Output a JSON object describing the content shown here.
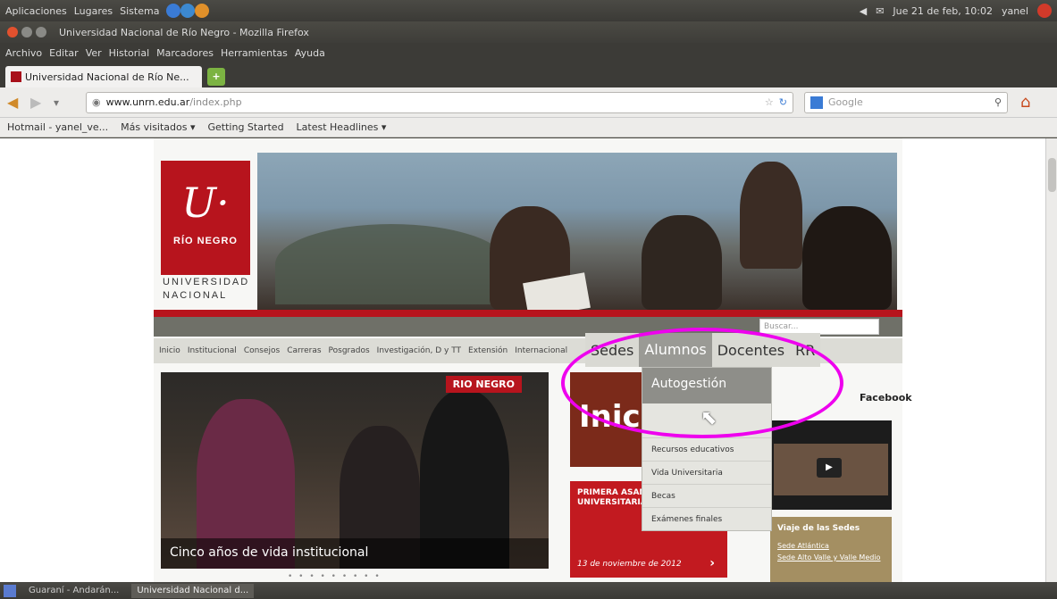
{
  "top_panel": {
    "menus": [
      "Aplicaciones",
      "Lugares",
      "Sistema"
    ],
    "clock": "Jue 21 de feb, 10:02",
    "user": "yanel"
  },
  "window": {
    "title": "Universidad Nacional de Río Negro - Mozilla Firefox"
  },
  "menubar": [
    "Archivo",
    "Editar",
    "Ver",
    "Historial",
    "Marcadores",
    "Herramientas",
    "Ayuda"
  ],
  "tab": {
    "label": "Universidad Nacional de Río Ne..."
  },
  "navbar": {
    "url_host": "www.unrn.edu.ar",
    "url_path": "/index.php",
    "search_placeholder": "Google"
  },
  "bookmarks": [
    "Hotmail - yanel_ve...",
    "Más visitados ▾",
    "Getting Started",
    "Latest Headlines ▾"
  ],
  "site": {
    "logo_u": "U·",
    "logo_rio": "RÍO NEGRO",
    "logo_univ": "UNIVERSIDAD",
    "logo_nac": "NACIONAL",
    "search_placeholder": "Buscar...",
    "nav": [
      "Inicio",
      "Institucional",
      "Consejos",
      "Carreras",
      "Posgrados",
      "Investigación, D y TT",
      "Extensión",
      "Internacional"
    ],
    "dropdown_nav": [
      "Sedes",
      "Alumnos",
      "Docentes",
      "RR"
    ],
    "dropdown_items": {
      "first": "Autogestión",
      "items": [
        "Recursos educativos",
        "Vida Universitaria",
        "Becas",
        "Exámenes finales"
      ]
    },
    "hero_label": "RIO NEGRO",
    "hero_caption": "Cinco años de vida institucional",
    "pager": "• • • • • • • • •",
    "card1_text": "Inic",
    "card2_title": "PRIMERA ASAMBLEA UNIVERSITARIA",
    "card2_date": "13 de noviembre de 2012",
    "card2_arrow": "›",
    "facebook": "Facebook",
    "play": "▶",
    "sedes_heading": "Viaje de las Sedes",
    "sedes_link1": "Sede Atlántica",
    "sedes_link2": "Sede Alto Valle y Valle Medio"
  },
  "taskbar": [
    "Guaraní - Andarán...",
    "Universidad Nacional d..."
  ]
}
